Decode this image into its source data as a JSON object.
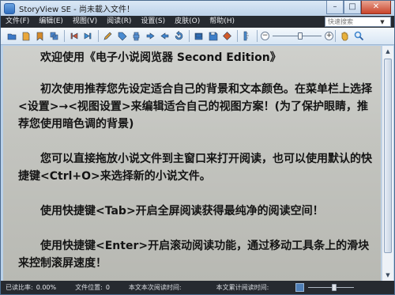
{
  "window": {
    "title": "StoryView SE - 尚未載入文件！",
    "controls": {
      "minimize": "–",
      "maximize": "□",
      "close": "✕"
    }
  },
  "menu": {
    "items": [
      "文件(F)",
      "编辑(E)",
      "视图(V)",
      "阅读(R)",
      "设置(S)",
      "皮肤(O)",
      "帮助(H)"
    ],
    "search_placeholder": "快速搜索",
    "search_dropdown": "▼"
  },
  "toolbar": {
    "buttons": [
      {
        "name": "open-icon",
        "color": "#3a78c6"
      },
      {
        "name": "new-icon",
        "color": "#e9a73b"
      },
      {
        "name": "bookmark-icon",
        "color": "#d58a2a"
      },
      {
        "name": "copy-icon",
        "color": "#4d88d0"
      },
      {
        "name": "prev-icon",
        "color": "#c85a3a"
      },
      {
        "name": "next-icon",
        "color": "#3b8ed4"
      },
      {
        "name": "edit-icon",
        "color": "#d89c34"
      },
      {
        "name": "tag-icon",
        "color": "#4a8bd1"
      },
      {
        "name": "print-icon",
        "color": "#5a94d6"
      },
      {
        "name": "back-icon",
        "color": "#3f86cf"
      },
      {
        "name": "forward-icon",
        "color": "#3f86cf"
      },
      {
        "name": "reload-icon",
        "color": "#4b8fd3"
      },
      {
        "name": "view-icon",
        "color": "#2f6fb8"
      },
      {
        "name": "save-icon",
        "color": "#3d7ec8"
      },
      {
        "name": "stop-icon",
        "color": "#d05a2a"
      },
      {
        "name": "ruler-icon",
        "color": "#4b8fd3"
      }
    ],
    "zoom_out": "−",
    "zoom_in": "+",
    "zoom_level": 0.6,
    "hand_color": "#e8b13c",
    "search_color": "#3f86cf"
  },
  "content": {
    "heading": "欢迎使用《电子小说阅览器 Second Edition》",
    "paragraphs": [
      "初次使用推荐您先设定适合自己的背景和文本颜色。在菜单栏上选择<设置>→<视图设置>来编辑适合自己的视图方案！(为了保护眼睛，推荐您使用暗色调的背景)",
      "您可以直接拖放小说文件到主窗口来打开阅读，也可以使用默认的快捷键<Ctrl+O>来选择新的小说文件。",
      "使用快捷键<Tab>开启全屏阅读获得最纯净的阅读空间！",
      "使用快捷键<Enter>开启滚动阅读功能，通过移动工具条上的滑块来控制滚屏速度！"
    ]
  },
  "statusbar": {
    "read_ratio_label": "已读比率:",
    "read_ratio_value": "0.00%",
    "position_label": "文件位置:",
    "position_value": "0",
    "read_time_label": "本文本次阅读时间:",
    "total_time_label": "本文累计阅读时间:",
    "scroll_speed": 0.6
  }
}
